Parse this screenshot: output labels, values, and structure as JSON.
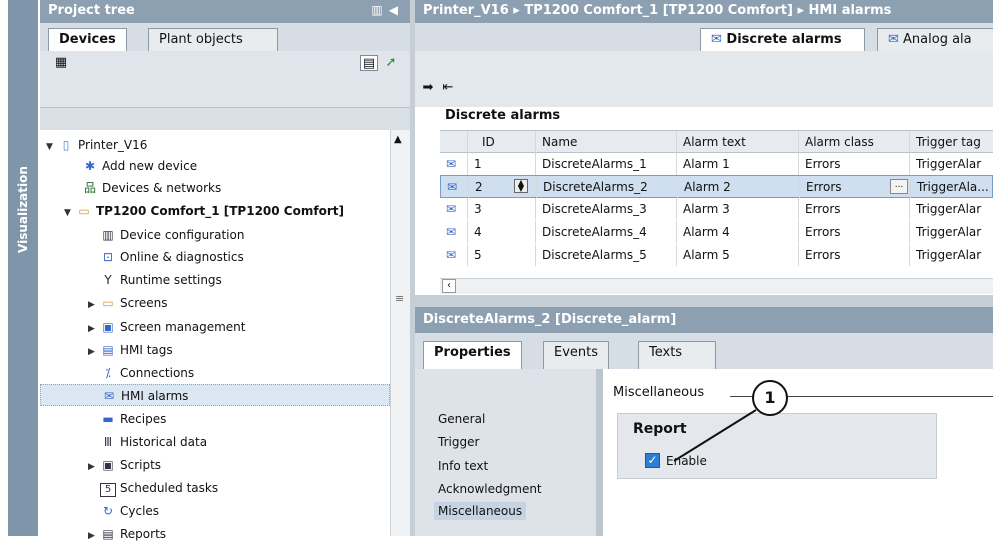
{
  "sidebar": {
    "label": "Visualization"
  },
  "project_tree": {
    "title": "Project tree",
    "tabs": [
      {
        "label": "Devices"
      },
      {
        "label": "Plant objects"
      }
    ],
    "items": [
      {
        "label": "Printer_V16",
        "icon": "project-icon"
      },
      {
        "label": "Add new device",
        "icon": "add-device-icon"
      },
      {
        "label": "Devices & networks",
        "icon": "network-icon"
      },
      {
        "label": "TP1200 Comfort_1 [TP1200 Comfort]",
        "icon": "hmi-device-icon"
      },
      {
        "label": "Device configuration",
        "icon": "device-config-icon"
      },
      {
        "label": "Online & diagnostics",
        "icon": "diagnostics-icon"
      },
      {
        "label": "Runtime settings",
        "icon": "wrench-icon"
      },
      {
        "label": "Screens",
        "icon": "folder-icon"
      },
      {
        "label": "Screen management",
        "icon": "screen-mgmt-icon"
      },
      {
        "label": "HMI tags",
        "icon": "tags-icon"
      },
      {
        "label": "Connections",
        "icon": "connections-icon"
      },
      {
        "label": "HMI alarms",
        "icon": "alarm-icon"
      },
      {
        "label": "Recipes",
        "icon": "recipes-icon"
      },
      {
        "label": "Historical data",
        "icon": "historical-icon"
      },
      {
        "label": "Scripts",
        "icon": "scripts-icon"
      },
      {
        "label": "Scheduled tasks",
        "icon": "tasks-icon"
      },
      {
        "label": "Cycles",
        "icon": "cycles-icon"
      },
      {
        "label": "Reports",
        "icon": "reports-icon"
      }
    ]
  },
  "editor": {
    "breadcrumb": "Printer_V16  ▸  TP1200 Comfort_1 [TP1200 Comfort]  ▸  HMI alarms",
    "tabs": [
      {
        "label": "Discrete alarms"
      },
      {
        "label": "Analog ala"
      }
    ],
    "section_title": "Discrete alarms",
    "columns": [
      "ID",
      "Name",
      "Alarm text",
      "Alarm class",
      "Trigger tag"
    ],
    "rows": [
      {
        "id": "1",
        "name": "DiscreteAlarms_1",
        "text": "Alarm 1",
        "class": "Errors",
        "trigger": "TriggerAlar"
      },
      {
        "id": "2",
        "name": "DiscreteAlarms_2",
        "text": "Alarm 2",
        "class": "Errors",
        "trigger": "TriggerAla..."
      },
      {
        "id": "3",
        "name": "DiscreteAlarms_3",
        "text": "Alarm 3",
        "class": "Errors",
        "trigger": "TriggerAlar"
      },
      {
        "id": "4",
        "name": "DiscreteAlarms_4",
        "text": "Alarm 4",
        "class": "Errors",
        "trigger": "TriggerAlar"
      },
      {
        "id": "5",
        "name": "DiscreteAlarms_5",
        "text": "Alarm 5",
        "class": "Errors",
        "trigger": "TriggerAlar"
      }
    ],
    "ellipsis": "..."
  },
  "inspector": {
    "title": "DiscreteAlarms_2 [Discrete_alarm]",
    "tabs": [
      {
        "label": "Properties"
      },
      {
        "label": "Events"
      },
      {
        "label": "Texts"
      }
    ],
    "nav": [
      "General",
      "Trigger",
      "Info text",
      "Acknowledgment",
      "Miscellaneous"
    ],
    "section": "Miscellaneous",
    "group_title": "Report",
    "enable_label": "Enable",
    "callout": "1"
  }
}
